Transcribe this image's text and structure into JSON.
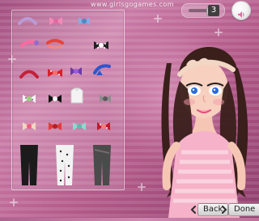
{
  "header": {
    "watermark_text": "www.girlsgogames.com"
  },
  "top_controls": {
    "music_count": "3",
    "round_button_icon": "speaker-icon"
  },
  "bottom_controls": {
    "back_label": "Back",
    "done_label": "Done"
  },
  "colors": {
    "background_pink": "#b35a8a",
    "panel_border": "#f6d6e8",
    "dress_pink": "#f6b2c8",
    "hair_brown": "#3a1f1b"
  },
  "items_panel": {
    "items": [
      {
        "name": "headband-lavender"
      },
      {
        "name": "bow-pink"
      },
      {
        "name": "bow-blue"
      },
      {
        "name": "hair-clip-pink"
      },
      {
        "name": "hair-clip-red"
      },
      {
        "name": "bow-black-polka"
      },
      {
        "name": "headband-red"
      },
      {
        "name": "bow-red-polka"
      },
      {
        "name": "bow-purple"
      },
      {
        "name": "ribbon-blue"
      },
      {
        "name": "bow-white-dots"
      },
      {
        "name": "bow-black"
      },
      {
        "name": "top-white"
      },
      {
        "name": "bow-gray"
      },
      {
        "name": "bow-cream"
      },
      {
        "name": "bow-red"
      },
      {
        "name": "bow-aqua"
      },
      {
        "name": "bow-red-polka-small"
      },
      {
        "name": "leggings-black"
      },
      {
        "name": "leggings-dots"
      },
      {
        "name": "leggings-gray"
      }
    ]
  }
}
